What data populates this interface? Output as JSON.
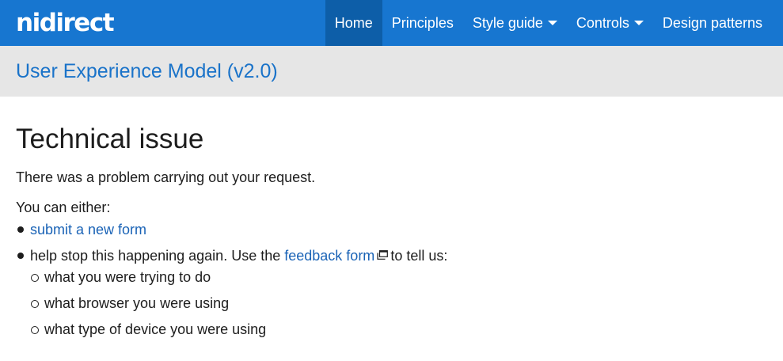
{
  "header": {
    "logo_text": "nidirect",
    "nav": [
      {
        "label": "Home",
        "active": true,
        "dropdown": false
      },
      {
        "label": "Principles",
        "active": false,
        "dropdown": false
      },
      {
        "label": "Style guide",
        "active": false,
        "dropdown": true
      },
      {
        "label": "Controls",
        "active": false,
        "dropdown": true
      },
      {
        "label": "Design patterns",
        "active": false,
        "dropdown": false
      }
    ],
    "bar_color": "#1776d0",
    "active_color": "#0d5ea8"
  },
  "banner": {
    "title": "User Experience Model (v2.0)"
  },
  "main": {
    "title": "Technical issue",
    "intro": "There was a problem carrying out your request.",
    "either": "You can either:",
    "option1_link": "submit a new form",
    "option2_prefix": "help stop this happening again. Use the",
    "option2_link": "feedback form",
    "option2_suffix": "to tell us:",
    "sub_items": [
      "what you were trying to do",
      "what browser you were using",
      "what type of device you were using"
    ]
  }
}
